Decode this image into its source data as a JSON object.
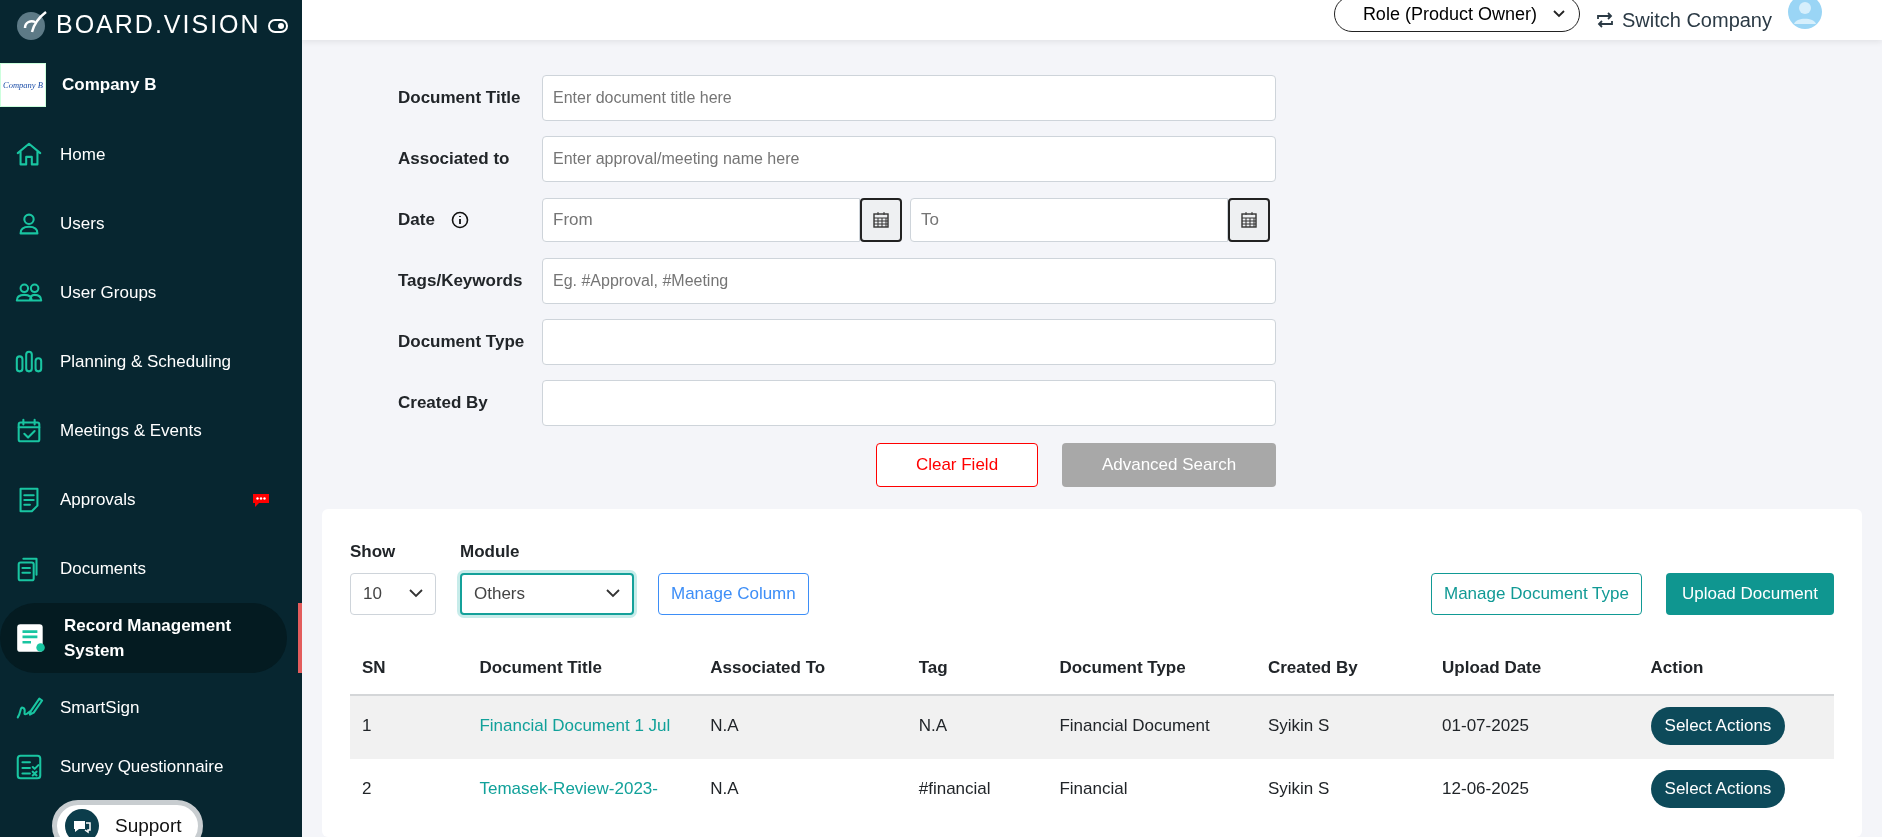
{
  "brand": {
    "name": "BOARD.VISION"
  },
  "company": {
    "name": "Company B",
    "logo_text": "Company B"
  },
  "sidebar": {
    "items": [
      {
        "label": "Home",
        "selected": false,
        "notification": false
      },
      {
        "label": "Users",
        "selected": false,
        "notification": false
      },
      {
        "label": "User Groups",
        "selected": false,
        "notification": false
      },
      {
        "label": "Planning & Scheduling",
        "selected": false,
        "notification": false
      },
      {
        "label": "Meetings & Events",
        "selected": false,
        "notification": false
      },
      {
        "label": "Approvals",
        "selected": false,
        "notification": true
      },
      {
        "label": "Documents",
        "selected": false,
        "notification": false
      },
      {
        "label": "Record Management System",
        "selected": true,
        "notification": false
      },
      {
        "label": "SmartSign",
        "selected": false,
        "notification": false
      },
      {
        "label": "Survey Questionnaire",
        "selected": false,
        "notification": false
      }
    ]
  },
  "topbar": {
    "role": "Role (Product Owner)",
    "switch_company": "Switch Company"
  },
  "search_form": {
    "fields": [
      {
        "kind": "text",
        "label": "Document Title",
        "placeholder": "Enter document title here"
      },
      {
        "kind": "text",
        "label": "Associated to",
        "placeholder": "Enter approval/meeting name here"
      },
      {
        "kind": "daterange",
        "label": "Date",
        "from_placeholder": "From",
        "to_placeholder": "To"
      },
      {
        "kind": "text",
        "label": "Tags/Keywords",
        "placeholder": "Eg. #Approval, #Meeting"
      },
      {
        "kind": "text",
        "label": "Document Type"
      },
      {
        "kind": "text",
        "label": "Created By"
      }
    ],
    "buttons": [
      {
        "label": "Clear Field",
        "kind": "danger",
        "disabled": false
      },
      {
        "label": "Advanced Search",
        "kind": "primary",
        "disabled": true
      }
    ]
  },
  "toolbar": {
    "show_label": "Show",
    "show_value": "10",
    "module_label": "Module",
    "module_value": "Others",
    "buttons": [
      {
        "label": "Manage Column",
        "kind": "outline-blue"
      },
      {
        "label": "Manage Document Type",
        "kind": "outline-teal"
      },
      {
        "label": "Upload Document",
        "kind": "solid-teal"
      }
    ]
  },
  "table": {
    "columns": [
      "SN",
      "Document Title",
      "Associated To",
      "Tag",
      "Document Type",
      "Created By",
      "Upload Date",
      "Action"
    ],
    "rows": [
      {
        "highlighted": true,
        "cells": [
          "1",
          "Financial Document 1 Jul",
          "N.A",
          "N.A",
          "Financial Document",
          "Syikin S",
          "01-07-2025"
        ],
        "action": "Select Actions"
      },
      {
        "highlighted": false,
        "cells": [
          "2",
          "Temasek-Review-2023-",
          "N.A",
          "#financial",
          "Financial",
          "Syikin S",
          "12-06-2025"
        ],
        "action": "Select Actions"
      }
    ]
  },
  "support": {
    "label": "Support"
  }
}
